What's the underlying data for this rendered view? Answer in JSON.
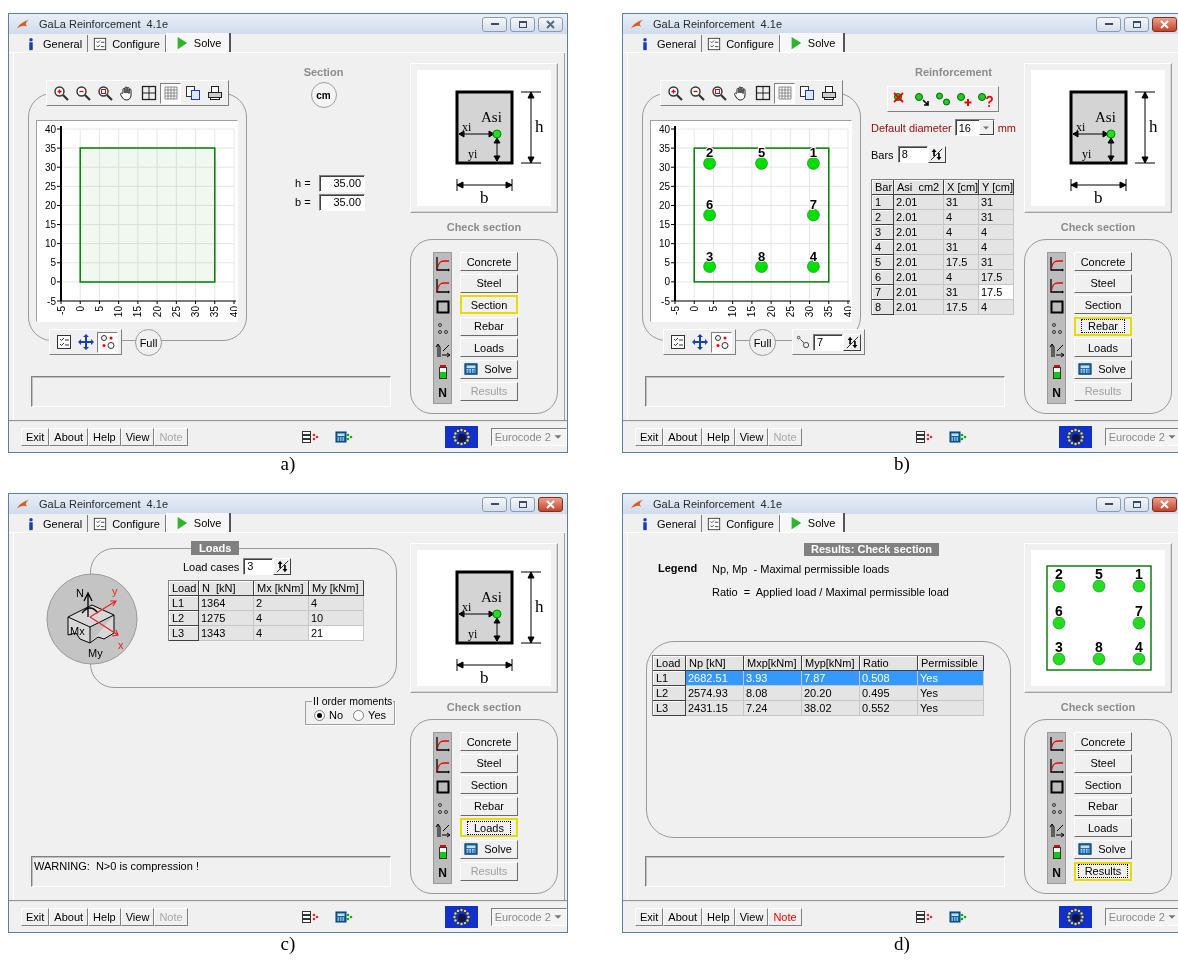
{
  "panels": [
    {
      "caption": "a)",
      "window": {
        "title": "GaLa Reinforcement  4.1e",
        "active": false,
        "tabs": [
          {
            "label": "General",
            "selected": false
          },
          {
            "label": "Configure",
            "selected": false
          },
          {
            "label": "Solve",
            "selected": true
          }
        ],
        "main": {
          "kind": "section",
          "chart": {
            "grid_pressed": true,
            "numbering_pressed": true,
            "full_label": "Full",
            "chart_data": {
              "type": "area",
              "grid": true,
              "x": [
                0,
                35
              ],
              "series": [
                {
                  "color": "#008000",
                  "values": [
                    35,
                    35
                  ]
                }
              ],
              "xlim": [
                -5,
                40
              ],
              "ylim": [
                -5,
                40
              ],
              "xticks": [
                -5,
                0,
                5,
                10,
                15,
                20,
                25,
                30,
                35,
                40
              ],
              "yticks": [
                -5,
                0,
                5,
                10,
                15,
                20,
                25,
                30,
                35,
                40
              ]
            }
          },
          "title": "Section",
          "unit": "cm",
          "fields": [
            {
              "label": "h =",
              "value": "35.00"
            },
            {
              "label": "b =",
              "value": "35.00"
            }
          ]
        },
        "preview": {
          "kind": "section-diagram",
          "labels": [
            "Asi",
            "xi",
            "yi",
            "h",
            "b"
          ]
        },
        "check_section": {
          "title": "Check section",
          "column_label": "N",
          "buttons": [
            {
              "label": "Concrete",
              "kind": "plain",
              "selected": false,
              "focused": false,
              "disabled": false
            },
            {
              "label": "Steel",
              "kind": "plain",
              "selected": false,
              "focused": false,
              "disabled": false
            },
            {
              "label": "Section",
              "kind": "plain",
              "selected": true,
              "focused": false,
              "disabled": false
            },
            {
              "label": "Rebar",
              "kind": "plain",
              "selected": false,
              "focused": false,
              "disabled": false
            },
            {
              "label": "Loads",
              "kind": "plain",
              "selected": false,
              "focused": false,
              "disabled": false
            },
            {
              "label": "Solve",
              "kind": "calc",
              "selected": false,
              "focused": false,
              "disabled": false
            },
            {
              "label": "Results",
              "kind": "plain",
              "selected": false,
              "focused": false,
              "disabled": true
            }
          ]
        },
        "footer": {
          "buttons": [
            {
              "label": "Exit",
              "disabled": false,
              "alert": false
            },
            {
              "label": "About",
              "disabled": false,
              "alert": false
            },
            {
              "label": "Help",
              "disabled": false,
              "alert": false
            },
            {
              "label": "View",
              "disabled": false,
              "alert": false
            },
            {
              "label": "Note",
              "disabled": true,
              "alert": false
            }
          ],
          "code": {
            "value": "Eurocode 2",
            "disabled": true
          }
        }
      }
    },
    {
      "caption": "b)",
      "window": {
        "title": "GaLa Reinforcement  4.1e",
        "active": true,
        "tabs": [
          {
            "label": "General",
            "selected": false
          },
          {
            "label": "Configure",
            "selected": false
          },
          {
            "label": "Solve",
            "selected": true
          }
        ],
        "main": {
          "kind": "reinforcement",
          "chart": {
            "grid_pressed": true,
            "numbering_pressed": true,
            "full_label": "Full",
            "bar_index": "7",
            "chart_data": {
              "type": "scatter",
              "grid": true,
              "x": [
                31,
                4,
                4,
                31,
                17.5,
                4,
                31,
                17.5
              ],
              "series": [
                {
                  "color": "#00e000",
                  "values": [
                    31,
                    31,
                    4,
                    4,
                    31,
                    17.5,
                    17.5,
                    4
                  ]
                }
              ],
              "xlim": [
                -5,
                40
              ],
              "ylim": [
                -5,
                40
              ],
              "xticks": [
                -5,
                0,
                5,
                10,
                15,
                20,
                25,
                30,
                35,
                40
              ],
              "yticks": [
                -5,
                0,
                5,
                10,
                15,
                20,
                25,
                30,
                35,
                40
              ],
              "annotations": [
                {
                  "x": 31,
                  "y": 31,
                  "text": "1"
                },
                {
                  "x": 4,
                  "y": 31,
                  "text": "2"
                },
                {
                  "x": 4,
                  "y": 4,
                  "text": "3"
                },
                {
                  "x": 31,
                  "y": 4,
                  "text": "4"
                },
                {
                  "x": 17.5,
                  "y": 31,
                  "text": "5"
                },
                {
                  "x": 4,
                  "y": 17.5,
                  "text": "6"
                },
                {
                  "x": 31,
                  "y": 17.5,
                  "text": "7"
                },
                {
                  "x": 17.5,
                  "y": 4,
                  "text": "8"
                }
              ]
            }
          },
          "title": "Reinforcement",
          "diameter": {
            "label": "Default diameter",
            "value": "16",
            "unit": "mm"
          },
          "bars": {
            "label": "Bars",
            "value": "8"
          },
          "table": {
            "columns": [
              "Bar",
              "Asi  cm2",
              "X [cm]",
              "Y [cm]"
            ],
            "rows": [
              {
                "cells": [
                  "1",
                  "2.01",
                  "31",
                  "31"
                ],
                "selected": false,
                "focused": false
              },
              {
                "cells": [
                  "2",
                  "2.01",
                  "4",
                  "31"
                ],
                "selected": false,
                "focused": false
              },
              {
                "cells": [
                  "3",
                  "2.01",
                  "4",
                  "4"
                ],
                "selected": false,
                "focused": false
              },
              {
                "cells": [
                  "4",
                  "2.01",
                  "31",
                  "4"
                ],
                "selected": false,
                "focused": false
              },
              {
                "cells": [
                  "5",
                  "2.01",
                  "17.5",
                  "31"
                ],
                "selected": false,
                "focused": false
              },
              {
                "cells": [
                  "6",
                  "2.01",
                  "4",
                  "17.5"
                ],
                "selected": false,
                "focused": false
              },
              {
                "cells": [
                  "7",
                  "2.01",
                  "31",
                  "17.5"
                ],
                "selected": false,
                "focused": true
              },
              {
                "cells": [
                  "8",
                  "2.01",
                  "17.5",
                  "4"
                ],
                "selected": false,
                "focused": false
              }
            ]
          }
        },
        "preview": {
          "kind": "section-diagram",
          "labels": [
            "Asi",
            "xi",
            "yi",
            "h",
            "b"
          ]
        },
        "check_section": {
          "title": "Check section",
          "column_label": "N",
          "buttons": [
            {
              "label": "Concrete",
              "kind": "plain",
              "selected": false,
              "focused": false,
              "disabled": false
            },
            {
              "label": "Steel",
              "kind": "plain",
              "selected": false,
              "focused": false,
              "disabled": false
            },
            {
              "label": "Section",
              "kind": "plain",
              "selected": false,
              "focused": false,
              "disabled": false
            },
            {
              "label": "Rebar",
              "kind": "plain",
              "selected": true,
              "focused": true,
              "disabled": false
            },
            {
              "label": "Loads",
              "kind": "plain",
              "selected": false,
              "focused": false,
              "disabled": false
            },
            {
              "label": "Solve",
              "kind": "calc",
              "selected": false,
              "focused": false,
              "disabled": false
            },
            {
              "label": "Results",
              "kind": "plain",
              "selected": false,
              "focused": false,
              "disabled": true
            }
          ]
        },
        "footer": {
          "buttons": [
            {
              "label": "Exit",
              "disabled": false,
              "alert": false
            },
            {
              "label": "About",
              "disabled": false,
              "alert": false
            },
            {
              "label": "Help",
              "disabled": false,
              "alert": false
            },
            {
              "label": "View",
              "disabled": false,
              "alert": false
            },
            {
              "label": "Note",
              "disabled": true,
              "alert": false
            }
          ],
          "code": {
            "value": "Eurocode 2",
            "disabled": true
          }
        }
      }
    },
    {
      "caption": "c)",
      "window": {
        "title": "GaLa Reinforcement  4.1e",
        "active": true,
        "tabs": [
          {
            "label": "General",
            "selected": false
          },
          {
            "label": "Configure",
            "selected": false
          },
          {
            "label": "Solve",
            "selected": true
          }
        ],
        "main": {
          "kind": "loads",
          "title": "Loads",
          "diagram_labels": [
            "N",
            "y",
            "Mx",
            "My",
            "x"
          ],
          "load_cases": {
            "label": "Load cases",
            "value": "3"
          },
          "table": {
            "columns": [
              "Load",
              "N  [kN]",
              "Mx [kNm]",
              "My [kNm]"
            ],
            "rows": [
              {
                "cells": [
                  "L1",
                  "1364",
                  "2",
                  "4"
                ],
                "selected": false,
                "focused": false
              },
              {
                "cells": [
                  "L2",
                  "1275",
                  "4",
                  "10"
                ],
                "selected": false,
                "focused": false
              },
              {
                "cells": [
                  "L3",
                  "1343",
                  "4",
                  "21"
                ],
                "selected": false,
                "focused": true
              }
            ]
          },
          "second_order": {
            "title": "II order moments",
            "options": [
              {
                "label": "No",
                "selected": true
              },
              {
                "label": "Yes",
                "selected": false
              }
            ]
          }
        },
        "message": "WARNING:  N>0 is compression !",
        "preview": {
          "kind": "section-diagram",
          "labels": [
            "Asi",
            "xi",
            "yi",
            "h",
            "b"
          ]
        },
        "check_section": {
          "title": "Check section",
          "column_label": "N",
          "buttons": [
            {
              "label": "Concrete",
              "kind": "plain",
              "selected": false,
              "focused": false,
              "disabled": false
            },
            {
              "label": "Steel",
              "kind": "plain",
              "selected": false,
              "focused": false,
              "disabled": false
            },
            {
              "label": "Section",
              "kind": "plain",
              "selected": false,
              "focused": false,
              "disabled": false
            },
            {
              "label": "Rebar",
              "kind": "plain",
              "selected": false,
              "focused": false,
              "disabled": false
            },
            {
              "label": "Loads",
              "kind": "plain",
              "selected": true,
              "focused": true,
              "disabled": false
            },
            {
              "label": "Solve",
              "kind": "calc",
              "selected": false,
              "focused": false,
              "disabled": false
            },
            {
              "label": "Results",
              "kind": "plain",
              "selected": false,
              "focused": false,
              "disabled": true
            }
          ]
        },
        "footer": {
          "buttons": [
            {
              "label": "Exit",
              "disabled": false,
              "alert": false
            },
            {
              "label": "About",
              "disabled": false,
              "alert": false
            },
            {
              "label": "Help",
              "disabled": false,
              "alert": false
            },
            {
              "label": "View",
              "disabled": false,
              "alert": false
            },
            {
              "label": "Note",
              "disabled": true,
              "alert": false
            }
          ],
          "code": {
            "value": "Eurocode 2",
            "disabled": true
          }
        }
      }
    },
    {
      "caption": "d)",
      "window": {
        "title": "GaLa Reinforcement  4.1e",
        "active": true,
        "tabs": [
          {
            "label": "General",
            "selected": false
          },
          {
            "label": "Configure",
            "selected": false
          },
          {
            "label": "Solve",
            "selected": true
          }
        ],
        "main": {
          "kind": "results",
          "title": "Results: Check section",
          "legend": {
            "title": "Legend",
            "lines": [
              "Np, Mp  - Maximal permissible loads",
              "Ratio  =  Applied load / Maximal permissible load"
            ]
          },
          "table": {
            "columns": [
              "Load",
              "Np [kN]",
              "Mxp[kNm]",
              "Myp[kNm]",
              "Ratio",
              "Permissible"
            ],
            "rows": [
              {
                "cells": [
                  "L1",
                  "2682.51",
                  "3.93",
                  "7.87",
                  "0.508",
                  "Yes"
                ],
                "selected": true,
                "focused": false
              },
              {
                "cells": [
                  "L2",
                  "2574.93",
                  "8.08",
                  "20.20",
                  "0.495",
                  "Yes"
                ],
                "selected": false,
                "focused": false
              },
              {
                "cells": [
                  "L3",
                  "2431.15",
                  "7.24",
                  "38.02",
                  "0.552",
                  "Yes"
                ],
                "selected": false,
                "focused": false
              }
            ]
          }
        },
        "preview": {
          "kind": "bar-layout",
          "rows": [
            {
              "bars": [
                "2",
                "5",
                "1"
              ]
            },
            {
              "bars": [
                "6",
                "7"
              ]
            },
            {
              "bars": [
                "3",
                "8",
                "4"
              ]
            }
          ]
        },
        "check_section": {
          "title": "Check section",
          "column_label": "N",
          "buttons": [
            {
              "label": "Concrete",
              "kind": "plain",
              "selected": false,
              "focused": false,
              "disabled": false
            },
            {
              "label": "Steel",
              "kind": "plain",
              "selected": false,
              "focused": false,
              "disabled": false
            },
            {
              "label": "Section",
              "kind": "plain",
              "selected": false,
              "focused": false,
              "disabled": false
            },
            {
              "label": "Rebar",
              "kind": "plain",
              "selected": false,
              "focused": false,
              "disabled": false
            },
            {
              "label": "Loads",
              "kind": "plain",
              "selected": false,
              "focused": false,
              "disabled": false
            },
            {
              "label": "Solve",
              "kind": "calc",
              "selected": false,
              "focused": false,
              "disabled": false
            },
            {
              "label": "Results",
              "kind": "plain",
              "selected": true,
              "focused": true,
              "disabled": false
            }
          ]
        },
        "footer": {
          "buttons": [
            {
              "label": "Exit",
              "disabled": false,
              "alert": false
            },
            {
              "label": "About",
              "disabled": false,
              "alert": false
            },
            {
              "label": "Help",
              "disabled": false,
              "alert": false
            },
            {
              "label": "View",
              "disabled": false,
              "alert": false
            },
            {
              "label": "Note",
              "disabled": false,
              "alert": true
            }
          ],
          "code": {
            "value": "Eurocode 2",
            "disabled": true
          }
        }
      }
    }
  ]
}
